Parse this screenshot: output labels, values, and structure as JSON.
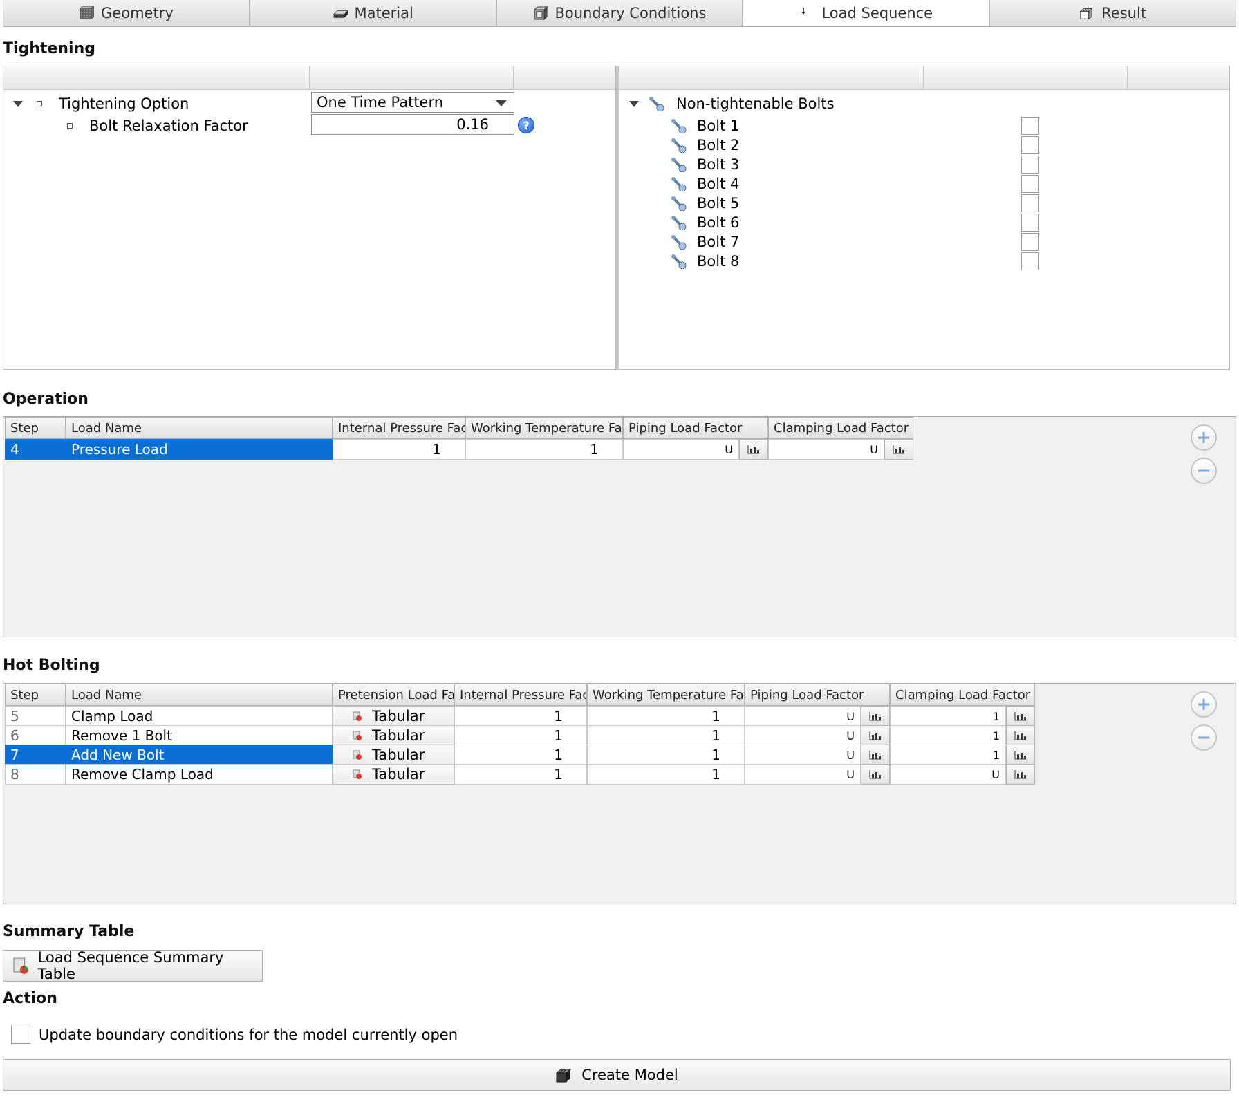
{
  "tabs": [
    {
      "label": "Geometry",
      "icon": "grid-cube-icon"
    },
    {
      "label": "Material",
      "icon": "material-plate-icon"
    },
    {
      "label": "Boundary Conditions",
      "icon": "boundary-box-icon"
    },
    {
      "label": "Load Sequence",
      "icon": "load-arrow-icon",
      "active": true
    },
    {
      "label": "Result",
      "icon": "result-stack-icon"
    }
  ],
  "tightening": {
    "title": "Tightening",
    "option_label": "Tightening Option",
    "option_value": "One Time Pattern",
    "relaxation_label": "Bolt Relaxation Factor",
    "relaxation_value": "0.16",
    "help_glyph": "?",
    "bolts_group_label": "Non-tightenable Bolts",
    "bolts": [
      "Bolt 1",
      "Bolt 2",
      "Bolt 3",
      "Bolt 4",
      "Bolt 5",
      "Bolt 6",
      "Bolt 7",
      "Bolt 8"
    ]
  },
  "operation": {
    "title": "Operation",
    "headers": [
      "Step",
      "Load Name",
      "Internal Pressure Factor",
      "Working Temperature Factor",
      "Piping Load Factor",
      "Clamping Load Factor"
    ],
    "rows": [
      {
        "step": "4",
        "name": "Pressure Load",
        "ipf": "1",
        "wtf": "1",
        "plf": "U",
        "clf": "U",
        "selected": true
      }
    ]
  },
  "hot_bolting": {
    "title": "Hot Bolting",
    "headers": [
      "Step",
      "Load Name",
      "Pretension Load Factor",
      "Internal Pressure Factor",
      "Working Temperature Factor",
      "Piping Load Factor",
      "Clamping Load Factor"
    ],
    "rows": [
      {
        "step": "5",
        "name": "Clamp Load",
        "plf_pre": "Tabular",
        "ipf": "1",
        "wtf": "1",
        "plf": "U",
        "clf": "1",
        "selected": false
      },
      {
        "step": "6",
        "name": "Remove 1 Bolt",
        "plf_pre": "Tabular",
        "ipf": "1",
        "wtf": "1",
        "plf": "U",
        "clf": "1",
        "selected": false
      },
      {
        "step": "7",
        "name": "Add New Bolt",
        "plf_pre": "Tabular",
        "ipf": "1",
        "wtf": "1",
        "plf": "U",
        "clf": "1",
        "selected": true
      },
      {
        "step": "8",
        "name": "Remove Clamp Load",
        "plf_pre": "Tabular",
        "ipf": "1",
        "wtf": "1",
        "plf": "U",
        "clf": "U",
        "selected": false
      }
    ]
  },
  "summary": {
    "title": "Summary Table",
    "button_label": "Load Sequence Summary Table"
  },
  "action": {
    "title": "Action",
    "checkbox_label": "Update boundary conditions for the model currently open",
    "create_label": "Create Model"
  },
  "glyphs": {
    "plus": "+",
    "minus": "−"
  },
  "colors": {
    "selection": "#0a6fd6",
    "help": "#1f5fcf"
  }
}
